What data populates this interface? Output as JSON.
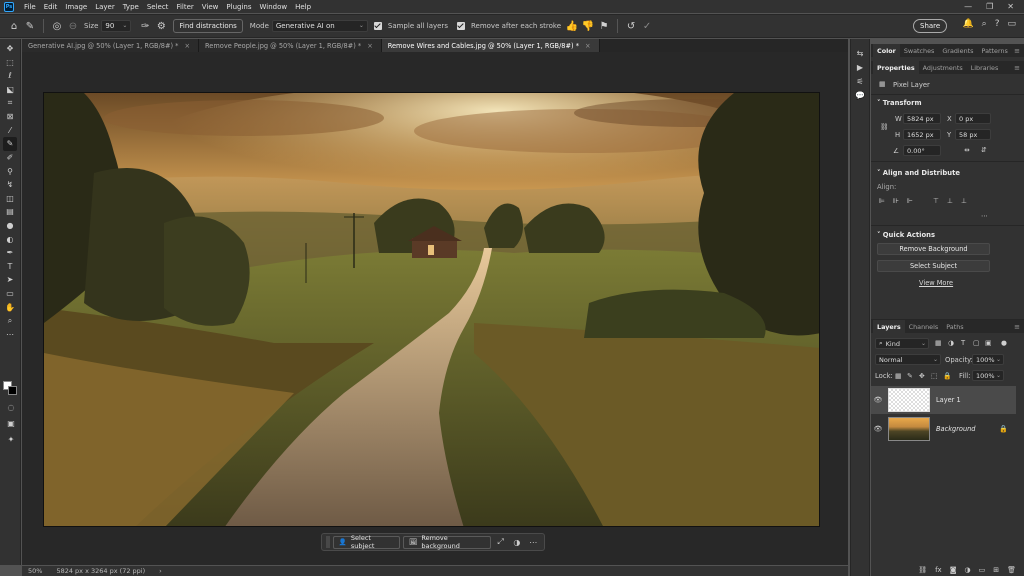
{
  "app": {
    "logo": "Ps"
  },
  "menu": [
    "File",
    "Edit",
    "Image",
    "Layer",
    "Type",
    "Select",
    "Filter",
    "View",
    "Plugins",
    "Window",
    "Help"
  ],
  "window_controls": [
    "—",
    "❐",
    "✕"
  ],
  "options": {
    "size_label": "Size",
    "size_value": "90",
    "find_distractions": "Find distractions",
    "mode_label": "Mode",
    "mode_value": "Generative AI on",
    "sample_all_layers": "Sample all layers",
    "remove_after_stroke": "Remove after each stroke",
    "share": "Share"
  },
  "tabs": [
    {
      "label": "Generative AI.jpg @ 50% (Layer 1, RGB/8#) *",
      "active": false
    },
    {
      "label": "Remove People.jpg @ 50% (Layer 1, RGB/8#) *",
      "active": false
    },
    {
      "label": "Remove Wires and Cables.jpg @ 50% (Layer 1, RGB/8#) *",
      "active": true
    }
  ],
  "context_bar": {
    "select_subject": "Select subject",
    "remove_background": "Remove background"
  },
  "status": {
    "zoom": "50%",
    "doc_size": "5824 px x 3264 px (72 ppi)"
  },
  "panel_top_tabs": [
    "Color",
    "Swatches",
    "Gradients",
    "Patterns"
  ],
  "properties_tabs": [
    "Properties",
    "Adjustments",
    "Libraries"
  ],
  "properties": {
    "type": "Pixel Layer",
    "transform_title": "Transform",
    "w_label": "W",
    "w_value": "5824 px",
    "h_label": "H",
    "h_value": "1652 px",
    "x_label": "X",
    "x_value": "0 px",
    "y_label": "Y",
    "y_value": "58 px",
    "angle_value": "0.00°",
    "align_title": "Align and Distribute",
    "align_label": "Align:",
    "quick_actions_title": "Quick Actions",
    "remove_background": "Remove Background",
    "select_subject": "Select Subject",
    "view_more": "View More"
  },
  "layers_tabs": [
    "Layers",
    "Channels",
    "Paths"
  ],
  "layers_panel": {
    "kind": "Kind",
    "blend_mode": "Normal",
    "opacity_label": "Opacity:",
    "opacity_value": "100%",
    "lock_label": "Lock:",
    "fill_label": "Fill:",
    "fill_value": "100%"
  },
  "layers": [
    {
      "name": "Layer 1",
      "selected": true
    },
    {
      "name": "Background",
      "selected": false,
      "locked": true
    }
  ]
}
